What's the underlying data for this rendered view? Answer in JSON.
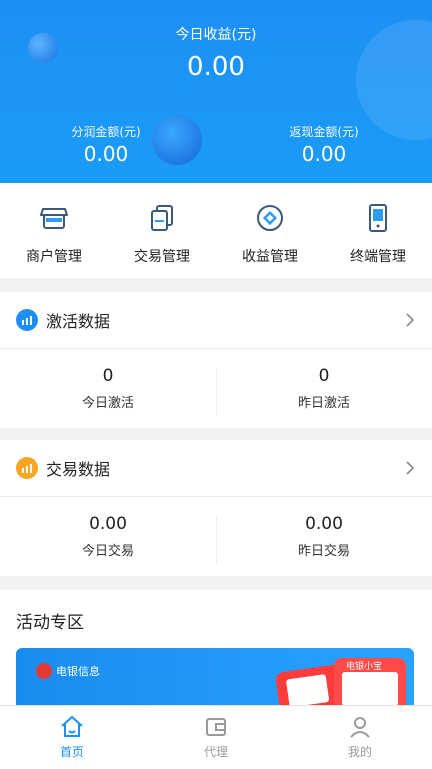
{
  "header": {
    "today_title": "今日收益(元)",
    "today_value": "0.00",
    "share_label": "分润金额(元)",
    "share_value": "0.00",
    "cashback_label": "返现金额(元)",
    "cashback_value": "0.00"
  },
  "menu": [
    {
      "label": "商户管理",
      "icon": "store-icon"
    },
    {
      "label": "交易管理",
      "icon": "documents-icon"
    },
    {
      "label": "收益管理",
      "icon": "earnings-icon"
    },
    {
      "label": "终端管理",
      "icon": "terminal-icon"
    }
  ],
  "activation": {
    "title": "激活数据",
    "today_value": "0",
    "today_label": "今日激活",
    "yesterday_value": "0",
    "yesterday_label": "昨日激活"
  },
  "transaction": {
    "title": "交易数据",
    "today_value": "0.00",
    "today_label": "今日交易",
    "yesterday_value": "0.00",
    "yesterday_label": "昨日交易"
  },
  "promo": {
    "title": "活动专区",
    "brand": "电银信息",
    "device_label": "电银小宝"
  },
  "tabs": [
    {
      "label": "首页",
      "active": true
    },
    {
      "label": "代理",
      "active": false
    },
    {
      "label": "我的",
      "active": false
    }
  ],
  "colors": {
    "primary": "#1e8ff5",
    "activation_badge": "#1e8ff5",
    "transaction_badge": "#f5a623"
  }
}
